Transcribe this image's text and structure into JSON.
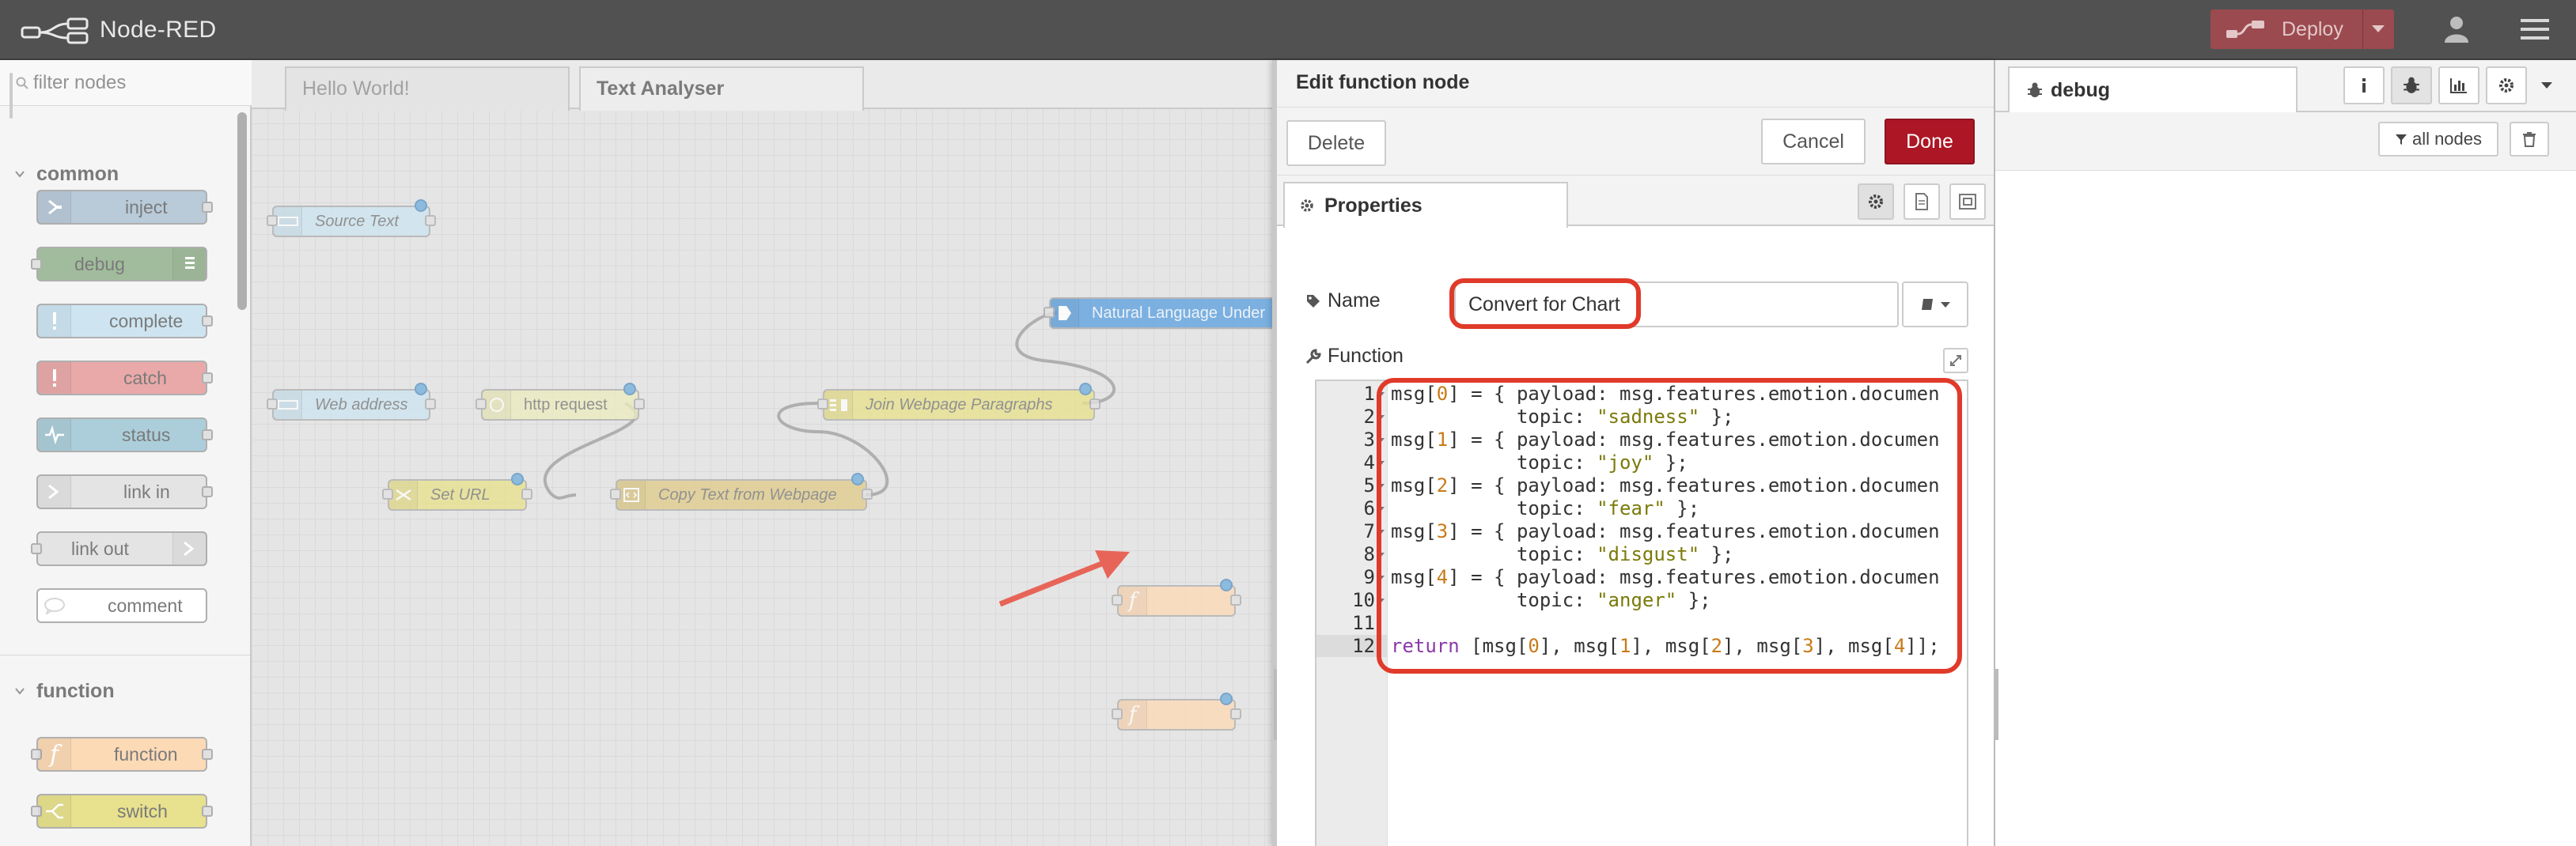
{
  "app": {
    "title": "Node-RED",
    "deploy_label": "Deploy"
  },
  "palette": {
    "search_placeholder": "filter nodes",
    "categories": [
      {
        "label": "common",
        "nodes": [
          "inject",
          "debug",
          "complete",
          "catch",
          "status",
          "link in",
          "link out",
          "comment"
        ]
      },
      {
        "label": "function",
        "nodes": [
          "function",
          "switch"
        ]
      }
    ],
    "colors": {
      "inject": "#a6bbcf",
      "debug": "#87a980",
      "complete": "#c0deed",
      "catch": "#e49191",
      "status": "#94c1d0",
      "link": "#dddddd",
      "comment": "#ffffff",
      "function": "#fdd0a2",
      "switch": "#e2d96e"
    }
  },
  "workspace": {
    "tabs": [
      "Hello World!",
      "Text Analyser"
    ],
    "active_tab": "Text Analyser",
    "nodes": {
      "source_text": "Source Text",
      "web_address": "Web address",
      "http_request": "http request",
      "join_paragraphs": "Join Webpage Paragraphs",
      "set_url": "Set URL",
      "copy_text": "Copy Text from Webpage",
      "nlu": "Natural Language Under"
    }
  },
  "tray": {
    "title": "Edit function node",
    "delete_label": "Delete",
    "cancel_label": "Cancel",
    "done_label": "Done",
    "properties_tab": "Properties",
    "name_label": "Name",
    "name_value": "Convert for Chart",
    "function_label": "Function",
    "code": {
      "lines": [
        "1",
        "2",
        "3",
        "4",
        "5",
        "6",
        "7",
        "8",
        "9",
        "10",
        "11",
        "12"
      ],
      "emotions": [
        "sadness",
        "joy",
        "fear",
        "disgust",
        "anger"
      ],
      "msg_prefix": "msg[",
      "assign_text": "] = { payload: msg.features.emotion.documen",
      "topic_text": "topic: ",
      "close_text": " };",
      "return_keyword": "return",
      "return_text": " [msg[0], msg[1], msg[2], msg[3], msg[4]];"
    }
  },
  "sidebar": {
    "tab_label": "debug",
    "filter_label": "all nodes"
  },
  "accent": {
    "deploy": "#9b4a4f",
    "done": "#ad1625",
    "highlight": "#e03a2a"
  }
}
